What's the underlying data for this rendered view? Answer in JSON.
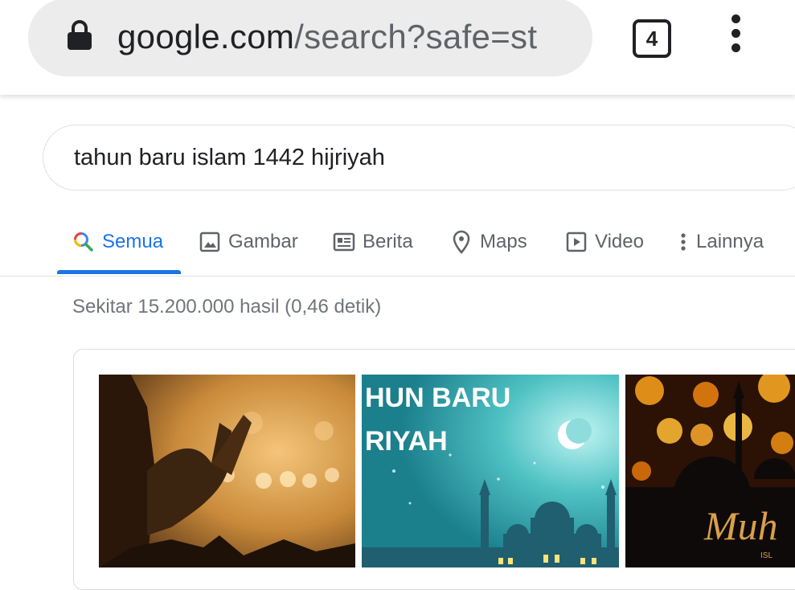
{
  "browser": {
    "url_host": "google.com",
    "url_path": "/search?safe=st",
    "tab_count": "4",
    "icons": [
      "lock-icon",
      "tabs-icon",
      "more-vert-icon"
    ]
  },
  "search": {
    "query": "tahun baru islam 1442 hijriyah"
  },
  "tabs": [
    {
      "label": "Semua",
      "icon": "search-icon",
      "active": true
    },
    {
      "label": "Gambar",
      "icon": "image-icon"
    },
    {
      "label": "Berita",
      "icon": "news-icon"
    },
    {
      "label": "Maps",
      "icon": "map-pin-icon"
    },
    {
      "label": "Video",
      "icon": "video-icon"
    },
    {
      "label": "Lainnya",
      "icon": "more-vert-icon"
    }
  ],
  "results": {
    "stats": "Sekitar 15.200.000 hasil (0,46 detik)"
  },
  "images": [
    {
      "name": "praying-hands-image"
    },
    {
      "name": "tahun-baru-hijriyah-image",
      "caption_line1": "HUN BARU",
      "caption_line2": "RIYAH"
    },
    {
      "name": "muharram-mosque-image",
      "caption": "Muh",
      "sub_caption": "ISL"
    }
  ],
  "colors": {
    "accent": "#1a73e8",
    "text_secondary": "#5f6368"
  }
}
